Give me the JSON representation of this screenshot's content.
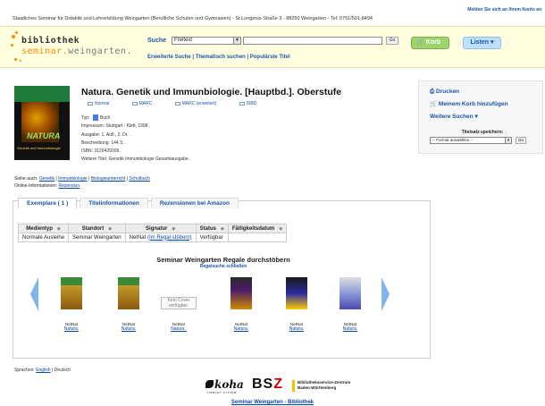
{
  "login_link": "Melden Sie sich an Ihrem Konto an",
  "institution": "Staatliches Seminar für Didaktik und Lehrerbildung Weingarten (Berufliche Schulen und Gymnasien) - St.Longinus-Straße 3 - 88250 Weingarten - Tel: 0751/501-8494",
  "logo": {
    "line1": "bibliothek",
    "line2_a": "seminar.",
    "line2_b": "weingarten."
  },
  "search": {
    "label": "Suche",
    "scope_selected": "Freitext",
    "go_label": "Go",
    "links": [
      "Erweiterte Suche",
      "Thematisch suchen",
      "Populärste Titel"
    ]
  },
  "buttons": {
    "korb": "Korb",
    "listen": "Listen"
  },
  "record": {
    "title": "Natura. Genetik und Immunbiologie. [Hauptbd.]. Oberstufe",
    "view_tabs": [
      "Normal",
      "MARC",
      "MARC (erweitert)",
      "ISBD"
    ],
    "typ_label": "Typ:",
    "typ_value": "Buch",
    "impressum_label": "Impressum:",
    "impressum_value": "Stuttgart : Klett, 1998 .",
    "ausgabe_label": "Ausgabe:",
    "ausgabe_value": "1. Aufl., 2. Dr. .",
    "beschreibung_label": "Beschreibung:",
    "beschreibung_value": "144 S. .",
    "isbn_label": "ISBN:",
    "isbn_value": "3120429309 .",
    "weitere_label": "Weitere Titel:",
    "weitere_value": "Genetik Immunbiologie Gesamtausgabe .",
    "cover_title": "NATURA",
    "cover_subtitle": "Genetik und Immunbiologie"
  },
  "see_also": {
    "label": "Siehe auch:",
    "links": [
      "Genetik",
      "Immunbiologie",
      "Biologieunterricht",
      "Schulbuch"
    ],
    "online_label": "Online-Informationen:",
    "online_link": "Rezension"
  },
  "sidebar": {
    "drucken": "Drucken",
    "korb_add": "Meinem Korb hinzufügen",
    "weitere_suchen": "Weitere Suchen",
    "cite_label": "Titelsatz speichern:",
    "cite_select": "-- Format auswählen --",
    "cite_go": "Go"
  },
  "tabs": [
    "Exemplare ( 1 )",
    "Titelinformationen",
    "Rezensionen bei Amazon"
  ],
  "holdings": {
    "headers": [
      "Medientyp",
      "Standort",
      "Signatur",
      "Status",
      "Fälligkeitsdatum"
    ],
    "row": {
      "medientyp": "Normale Ausleihe",
      "standort": "Seminar Weingarten",
      "signatur": "NetNat",
      "regal_link": "(Im Regal stöbern)",
      "status": "Verfügbar",
      "faellig": ""
    }
  },
  "shelf": {
    "title": "Seminar Weingarten Regale durchstöbern",
    "close": "Regalsuche schließen",
    "items": [
      {
        "callno": "NetNat",
        "title": "Natura."
      },
      {
        "callno": "NetNat",
        "title": "Natura."
      },
      {
        "callno": "NetNat",
        "title": "Natura :",
        "no_cover": "Kein Cover verfügbar."
      },
      {
        "callno": "NetNat",
        "title": "Natura."
      },
      {
        "callno": "NetNat",
        "title": "Natura."
      },
      {
        "callno": "NetNat",
        "title": "Natura."
      }
    ]
  },
  "footer": {
    "lang_label": "Sprachen:",
    "lang_english": "English",
    "lang_deutsch": "Deutsch",
    "koha": "koha",
    "koha_sub": "LIBRARY SYSTEM",
    "bsz_a": "BS",
    "bsz_b": "Z",
    "bsz_line1": "Bibliotheksservice-Zentrum",
    "bsz_line2": "Baden-Württemberg",
    "link": "Seminar Weingarten - Bibliothek"
  },
  "colors": {
    "accent_link": "#1a55a8",
    "header_bg": "#ffffe0",
    "korb_green": "#9fd36b",
    "listen_blue": "#bde0ff",
    "logo_orange": "#ff8800"
  }
}
